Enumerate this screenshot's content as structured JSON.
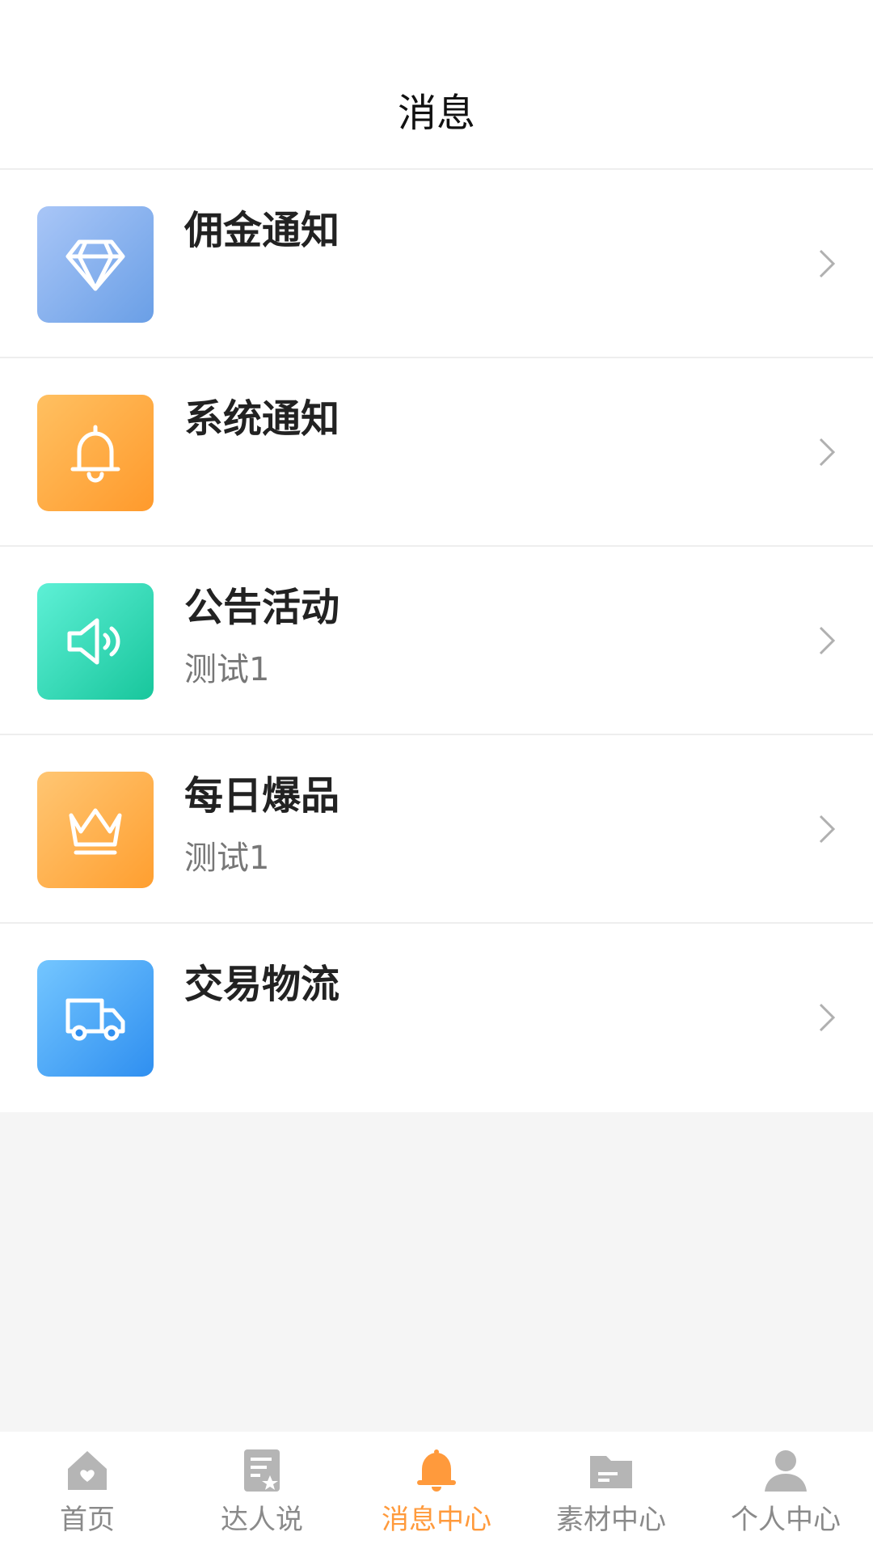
{
  "header": {
    "title": "消息"
  },
  "messages": [
    {
      "id": "commission",
      "label": "佣金通知",
      "sub": "",
      "icon": "diamond-icon",
      "gradient": [
        "#a9c6f7",
        "#6a9fe6"
      ]
    },
    {
      "id": "system",
      "label": "系统通知",
      "sub": "",
      "icon": "bell-icon",
      "gradient": [
        "#ffc061",
        "#ff9a2c"
      ]
    },
    {
      "id": "announcement",
      "label": "公告活动",
      "sub": "测试1",
      "icon": "speaker-icon",
      "gradient": [
        "#5ef0d6",
        "#18c69c"
      ]
    },
    {
      "id": "daily-hot",
      "label": "每日爆品",
      "sub": "测试1",
      "icon": "crown-icon",
      "gradient": [
        "#ffc673",
        "#ff9f30"
      ]
    },
    {
      "id": "logistics",
      "label": "交易物流",
      "sub": "",
      "icon": "truck-icon",
      "gradient": [
        "#74c6ff",
        "#2f8ff0"
      ]
    }
  ],
  "tabbar": {
    "items": [
      {
        "label": "首页",
        "icon": "home-icon",
        "active": false
      },
      {
        "label": "达人说",
        "icon": "document-star-icon",
        "active": false
      },
      {
        "label": "消息中心",
        "icon": "bell-icon",
        "active": true
      },
      {
        "label": "素材中心",
        "icon": "folder-icon",
        "active": false
      },
      {
        "label": "个人中心",
        "icon": "user-icon",
        "active": false
      }
    ]
  },
  "colors": {
    "active": "#ff9a3c",
    "inactive": "#b5b5b5"
  }
}
